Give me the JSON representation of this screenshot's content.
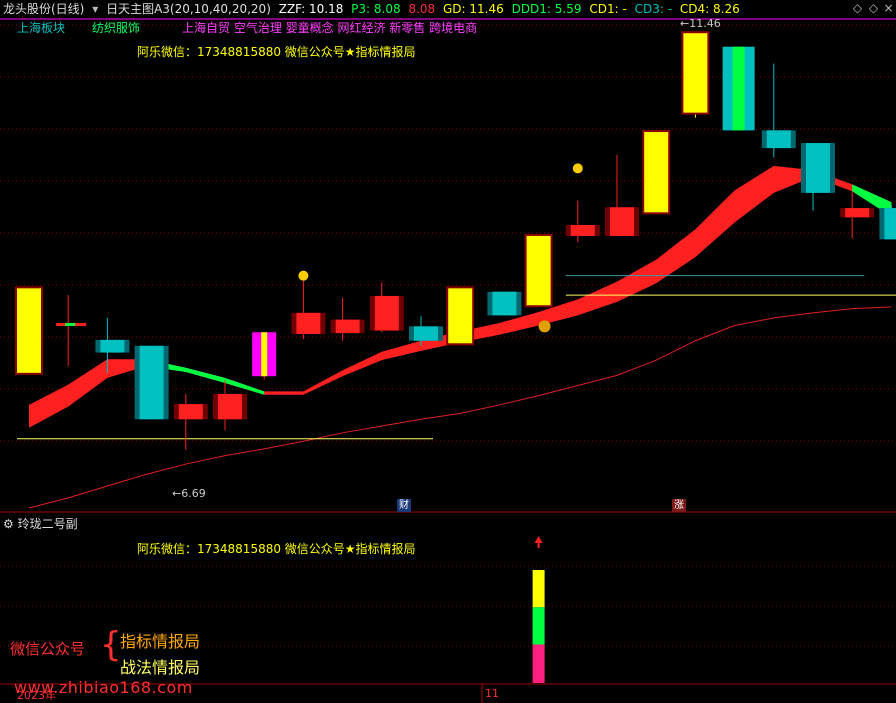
{
  "header": {
    "stock": "龙头股份(日线)",
    "indicator": "日天主图A3(20,10,40,20,20)",
    "zzf": "ZZF: 10.18",
    "p3": "P3: 8.08",
    "p3b": "8.08",
    "gd": "GD: 11.46",
    "ddd1": "DDD1: 5.59",
    "cd1": "CD1: -",
    "cd3": "CD3: -",
    "cd4": "CD4: 8.26"
  },
  "tags": {
    "region": "上海板块",
    "industry": "纺织服饰",
    "concepts": "上海自贸 空气治理 婴童概念 网红经济 新零售 跨境电商"
  },
  "watermark": "阿乐微信：17348815880  微信公众号★指标情报局",
  "labels": {
    "high": "11.46",
    "low": "6.69",
    "cai": "财",
    "zhang": "涨"
  },
  "sub_panel": {
    "title": "玲珑二号副",
    "watermark": "阿乐微信：17348815880  微信公众号★指标情报局"
  },
  "promo": {
    "left": "微信公众号",
    "line1": "指标情报局",
    "line2": "战法情报局"
  },
  "website": "www.zhibiao168.com",
  "axis": {
    "year": "2023年",
    "month": "11"
  },
  "colors": {
    "up": "#ff2020",
    "down": "#00c0c0",
    "yellow": "#ffff00",
    "green": "#00ff40",
    "magenta": "#ff00ff",
    "dash": "#7a0000"
  },
  "chart_data": {
    "type": "candlestick",
    "price_range": [
      6.0,
      11.8
    ],
    "candles": [
      {
        "o": 7.6,
        "h": 8.6,
        "l": 7.6,
        "c": 8.6,
        "style": "yellow"
      },
      {
        "o": 8.17,
        "h": 8.52,
        "l": 7.68,
        "c": 8.19,
        "style": "mixed"
      },
      {
        "o": 7.99,
        "h": 8.25,
        "l": 7.6,
        "c": 7.84,
        "style": "down"
      },
      {
        "o": 7.92,
        "h": 7.92,
        "l": 7.05,
        "c": 7.05,
        "style": "down"
      },
      {
        "o": 7.05,
        "h": 7.35,
        "l": 6.69,
        "c": 7.23,
        "style": "up"
      },
      {
        "o": 7.05,
        "h": 7.51,
        "l": 6.92,
        "c": 7.35,
        "style": "up"
      },
      {
        "o": 7.56,
        "h": 8.08,
        "l": 7.52,
        "c": 8.08,
        "style": "stripe"
      },
      {
        "o": 8.06,
        "h": 8.69,
        "l": 8.0,
        "c": 8.31,
        "style": "up"
      },
      {
        "o": 8.07,
        "h": 8.49,
        "l": 7.98,
        "c": 8.23,
        "style": "up"
      },
      {
        "o": 8.1,
        "h": 8.67,
        "l": 8.08,
        "c": 8.51,
        "style": "up"
      },
      {
        "o": 8.15,
        "h": 8.27,
        "l": 7.92,
        "c": 7.98,
        "style": "down"
      },
      {
        "o": 7.95,
        "h": 8.6,
        "l": 7.95,
        "c": 8.6,
        "style": "yellow"
      },
      {
        "o": 8.56,
        "h": 8.56,
        "l": 8.28,
        "c": 8.28,
        "style": "down"
      },
      {
        "o": 8.4,
        "h": 9.22,
        "l": 8.4,
        "c": 9.22,
        "style": "yellow"
      },
      {
        "o": 9.22,
        "h": 9.64,
        "l": 9.15,
        "c": 9.35,
        "style": "up"
      },
      {
        "o": 9.22,
        "h": 10.18,
        "l": 9.22,
        "c": 9.56,
        "style": "up"
      },
      {
        "o": 9.5,
        "h": 10.45,
        "l": 9.5,
        "c": 10.45,
        "style": "yellow"
      },
      {
        "o": 10.68,
        "h": 11.62,
        "l": 10.62,
        "c": 11.62,
        "style": "yellow"
      },
      {
        "o": 11.46,
        "h": 11.46,
        "l": 10.47,
        "c": 10.47,
        "style": "green"
      },
      {
        "o": 10.47,
        "h": 11.26,
        "l": 10.15,
        "c": 10.26,
        "style": "down"
      },
      {
        "o": 10.32,
        "h": 10.32,
        "l": 9.52,
        "c": 9.73,
        "style": "down"
      },
      {
        "o": 9.55,
        "h": 9.75,
        "l": 9.19,
        "c": 9.44,
        "style": "up"
      },
      {
        "o": 9.55,
        "h": 9.59,
        "l": 9.18,
        "c": 9.18,
        "style": "down"
      }
    ],
    "ribbon_upper": [
      7.22,
      7.46,
      7.76,
      7.76,
      7.66,
      7.54,
      7.38,
      7.38,
      7.63,
      7.85,
      7.98,
      8.09,
      8.19,
      8.32,
      8.47,
      8.68,
      8.94,
      9.3,
      9.76,
      10.05,
      10.0,
      9.83,
      9.62
    ],
    "ribbon_lower": [
      6.95,
      7.2,
      7.54,
      7.68,
      7.61,
      7.48,
      7.34,
      7.34,
      7.56,
      7.75,
      7.86,
      7.96,
      8.05,
      8.16,
      8.28,
      8.44,
      8.66,
      8.97,
      9.38,
      9.73,
      9.92,
      9.75,
      9.45
    ],
    "ribbon_green_ranges": [
      [
        3,
        6
      ],
      [
        21,
        22
      ]
    ],
    "ma_line": [
      6.0,
      6.12,
      6.26,
      6.4,
      6.52,
      6.62,
      6.7,
      6.79,
      6.89,
      6.97,
      7.05,
      7.12,
      7.22,
      7.33,
      7.45,
      7.57,
      7.75,
      7.98,
      8.16,
      8.25,
      8.31,
      8.36,
      8.38
    ],
    "hlines": [
      {
        "from": 0,
        "to": 10,
        "price": 6.82,
        "color": "#ffff66"
      },
      {
        "from": 14,
        "to": 21,
        "price": 8.75,
        "color": "#3a9aa0"
      },
      {
        "from": 14,
        "to": 22,
        "price": 8.52,
        "color": "#ffff66"
      }
    ],
    "dots": [
      {
        "i": 7,
        "price": 8.75
      },
      {
        "i": 14,
        "price": 10.02
      }
    ],
    "money_bag_index": 13,
    "sub_bar": {
      "index": 13,
      "segments": [
        {
          "color": "#ffff00",
          "frac": 0.33
        },
        {
          "color": "#00ff40",
          "frac": 0.33
        },
        {
          "color": "#ff2080",
          "frac": 0.34
        }
      ]
    }
  }
}
